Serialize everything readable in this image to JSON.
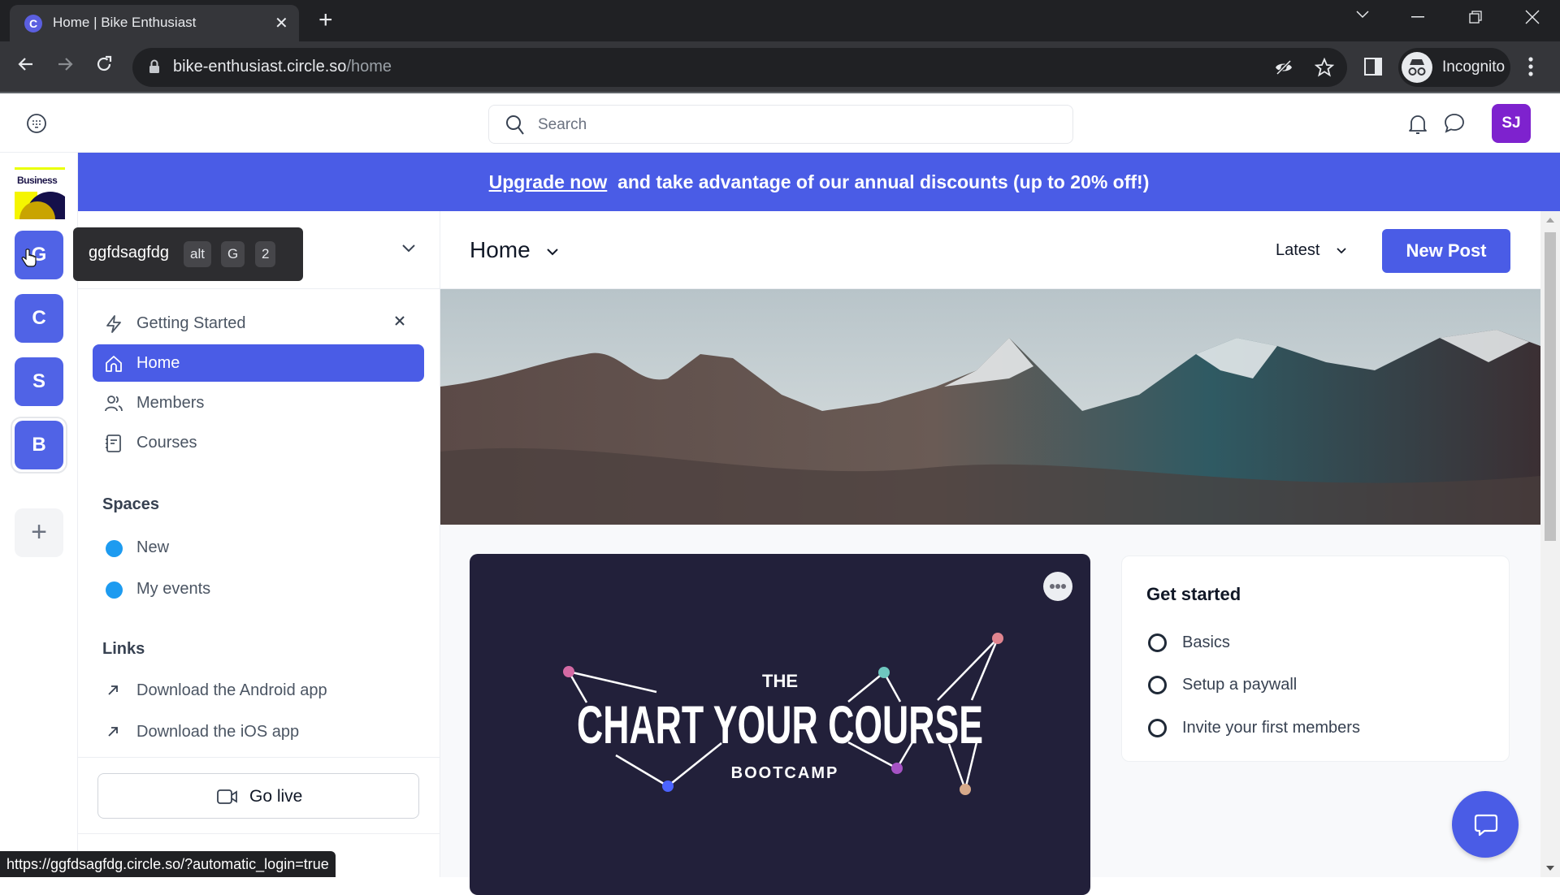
{
  "browser": {
    "tab_title": "Home | Bike Enthusiast",
    "tab_favicon_letter": "C",
    "url_host": "bike-enthusiast.circle.so",
    "url_path": "/home",
    "profile_label": "Incognito",
    "status_url": "https://ggfdsagfdg.circle.so/?automatic_login=true"
  },
  "header": {
    "search_placeholder": "Search",
    "user_initials": "SJ"
  },
  "communities": [
    {
      "label": "Business",
      "type": "logo"
    },
    {
      "letter": "G",
      "name": "ggfdsagfdg"
    },
    {
      "letter": "C"
    },
    {
      "letter": "S"
    },
    {
      "letter": "B",
      "selected": true
    }
  ],
  "tooltip": {
    "name": "ggfdsagfdg",
    "keys": [
      "alt",
      "G",
      "2"
    ]
  },
  "banner": {
    "link": "Upgrade now",
    "text": "and take advantage of our annual discounts (up to 20% off!)"
  },
  "sidebar": {
    "nav": [
      {
        "label": "Getting Started",
        "icon": "lightning-icon",
        "dismissible": true
      },
      {
        "label": "Home",
        "icon": "home-icon",
        "active": true
      },
      {
        "label": "Members",
        "icon": "members-icon"
      },
      {
        "label": "Courses",
        "icon": "courses-icon"
      }
    ],
    "spaces_title": "Spaces",
    "spaces": [
      {
        "label": "New",
        "color": "#1d9bf0"
      },
      {
        "label": "My events",
        "color": "#1d9bf0"
      }
    ],
    "links_title": "Links",
    "links": [
      {
        "label": "Download the Android app"
      },
      {
        "label": "Download the iOS app"
      }
    ],
    "go_live": "Go live"
  },
  "main": {
    "title": "Home",
    "sort": "Latest",
    "new_post": "New Post",
    "post": {
      "line1": "THE",
      "line2": "CHART YOUR COURSE",
      "line3": "BOOTCAMP"
    },
    "get_started": {
      "title": "Get started",
      "items": [
        {
          "label": "Basics",
          "done": false
        },
        {
          "label": "Setup a paywall",
          "done": false
        },
        {
          "label": "Invite your first members",
          "done": false
        }
      ]
    }
  },
  "colors": {
    "accent": "#4a5ce6",
    "avatar": "#7e22ce",
    "space_dot": "#1d9bf0",
    "post_bg": "#22203a"
  }
}
